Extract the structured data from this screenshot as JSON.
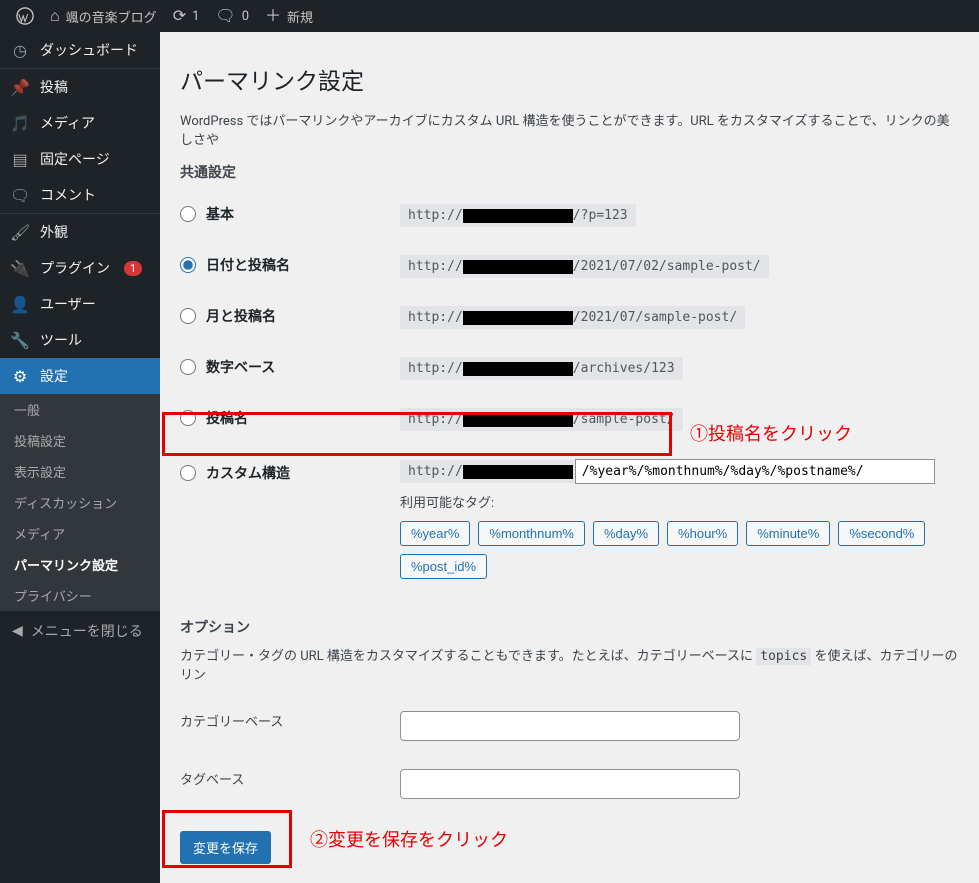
{
  "adminbar": {
    "site_name": "颯の音楽ブログ",
    "updates_count": "1",
    "comments_count": "0",
    "new_label": "新規"
  },
  "sidebar": {
    "dashboard": "ダッシュボード",
    "posts": "投稿",
    "media": "メディア",
    "pages": "固定ページ",
    "comments": "コメント",
    "appearance": "外観",
    "plugins": "プラグイン",
    "plugins_badge": "1",
    "users": "ユーザー",
    "tools": "ツール",
    "settings": "設定",
    "settings_sub": {
      "general": "一般",
      "writing": "投稿設定",
      "reading": "表示設定",
      "discussion": "ディスカッション",
      "media": "メディア",
      "permalink": "パーマリンク設定",
      "privacy": "プライバシー"
    },
    "collapse": "メニューを閉じる"
  },
  "page": {
    "title": "パーマリンク設定",
    "intro": "WordPress ではパーマリンクやアーカイブにカスタム URL 構造を使うことができます。URL をカスタマイズすることで、リンクの美しさや",
    "common_heading": "共通設定",
    "options": {
      "plain": {
        "label": "基本",
        "prefix": "http://",
        "suffix": "/?p=123"
      },
      "date_name": {
        "label": "日付と投稿名",
        "prefix": "http://",
        "suffix": "/2021/07/02/sample-post/"
      },
      "month_name": {
        "label": "月と投稿名",
        "prefix": "http://",
        "suffix": "/2021/07/sample-post/"
      },
      "numeric": {
        "label": "数字ベース",
        "prefix": "http://",
        "suffix": "/archives/123"
      },
      "post_name": {
        "label": "投稿名",
        "prefix": "http://",
        "suffix": "/sample-post/"
      },
      "custom": {
        "label": "カスタム構造",
        "prefix": "http://",
        "value": "/%year%/%monthnum%/%day%/%postname%/"
      }
    },
    "available_tags_label": "利用可能なタグ:",
    "tags": [
      "%year%",
      "%monthnum%",
      "%day%",
      "%hour%",
      "%minute%",
      "%second%",
      "%post_id%"
    ],
    "optional_heading": "オプション",
    "optional_desc_pre": "カテゴリー・タグの URL 構造をカスタマイズすることもできます。たとえば、カテゴリーベースに ",
    "optional_desc_code": "topics",
    "optional_desc_post": " を使えば、カテゴリーのリン",
    "category_base_label": "カテゴリーベース",
    "tag_base_label": "タグベース",
    "save_label": "変更を保存"
  },
  "annotations": {
    "a1": "①投稿名をクリック",
    "a2": "②変更を保存をクリック"
  }
}
